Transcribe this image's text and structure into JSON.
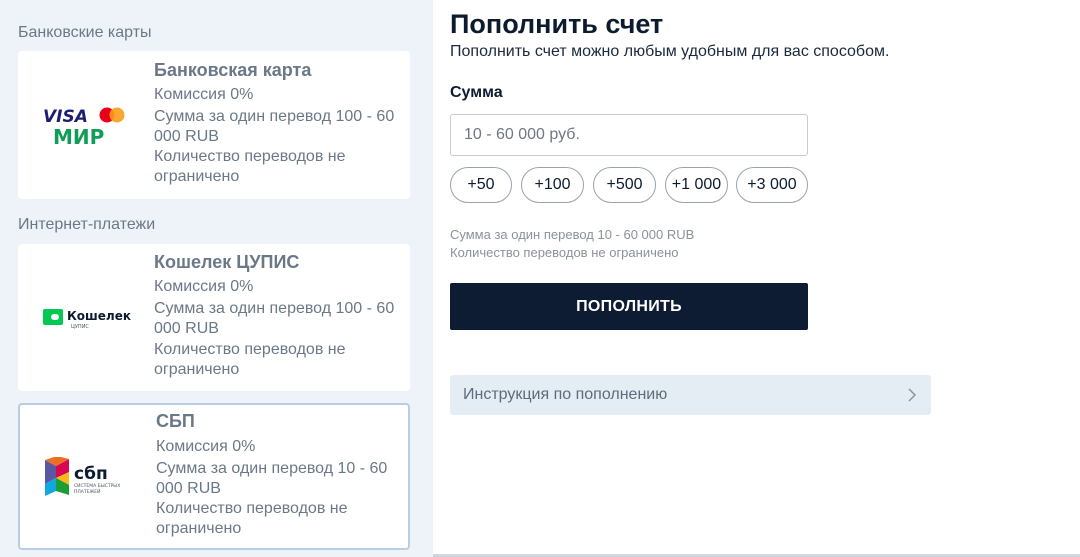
{
  "colors": {
    "left_bg": "#eef3fa",
    "card_text": "#6b7888",
    "primary_button": "#0d1b33",
    "selected_border": "#b9cde3",
    "visa_blue": "#1a1f71",
    "mastercard_red": "#eb001b",
    "mastercard_orange": "#f79e1b",
    "mir_green": "#0f9d58",
    "wallet_green": "#00c853"
  },
  "sections": [
    {
      "title": "Банковские карты"
    },
    {
      "title": "Интернет-платежи"
    }
  ],
  "methods": [
    {
      "title": "Банковская карта",
      "commission": "Комиссия 0%",
      "limit_line1": "Сумма за один перевод 100 - 60",
      "limit_line2": "000 RUB",
      "count_line1": "Количество переводов не",
      "count_line2": "ограничено",
      "logo": {
        "visa": "VISA",
        "mir": "МИР",
        "icon": "visa-mastercard-mir-icon"
      }
    },
    {
      "title": "Кошелек ЦУПИС",
      "commission": "Комиссия 0%",
      "limit_line1": "Сумма за один перевод 100 - 60",
      "limit_line2": "000 RUB",
      "count_line1": "Количество переводов не",
      "count_line2": "ограничено",
      "logo": {
        "name": "Кошелек",
        "sub": "ЦУПИС",
        "icon": "cupis-wallet-icon"
      }
    },
    {
      "title": "СБП",
      "commission": "Комиссия 0%",
      "limit_line1": "Сумма за один перевод 10 - 60",
      "limit_line2": "000 RUB",
      "count_line1": "Количество переводов не",
      "count_line2": "ограничено",
      "selected": true,
      "logo": {
        "name": "сбп",
        "sub1": "СИСТЕМА БЫСТРЫХ",
        "sub2": "ПЛАТЕЖЕЙ",
        "icon": "sbp-icon"
      }
    }
  ],
  "form": {
    "title": "Пополнить счет",
    "subtitle": "Пополнить счет можно любым удобным для вас способом.",
    "amount_label": "Сумма",
    "amount_placeholder": "10 - 60 000 руб.",
    "amount_value": "",
    "quick_amounts": [
      "+50",
      "+100",
      "+500",
      "+1 000",
      "+3 000"
    ],
    "limit_text": "Сумма за один перевод 10 - 60 000 RUB",
    "count_text": "Количество переводов не ограничено",
    "submit_label": "ПОПОЛНИТЬ",
    "instructions_label": "Инструкция по пополнению",
    "instructions_icon": "chevron-right-icon"
  }
}
